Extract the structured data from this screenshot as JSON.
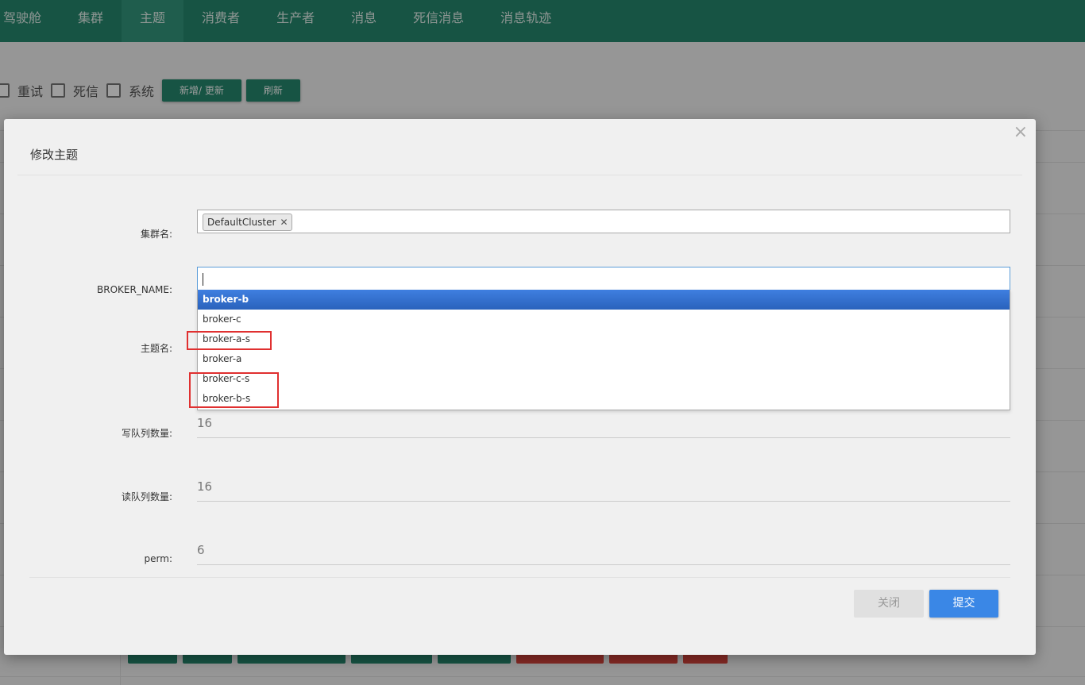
{
  "nav": {
    "items": [
      {
        "label": "驾驶舱"
      },
      {
        "label": "集群"
      },
      {
        "label": "主题"
      },
      {
        "label": "消费者"
      },
      {
        "label": "生产者"
      },
      {
        "label": "消息"
      },
      {
        "label": "死信消息"
      },
      {
        "label": "消息轨迹"
      }
    ],
    "active_index": 2
  },
  "filters": {
    "checkboxes": [
      {
        "label": "重试"
      },
      {
        "label": "死信"
      },
      {
        "label": "系统"
      }
    ],
    "add_update_label": "新增/ 更新",
    "refresh_label": "刷新"
  },
  "modal": {
    "title": "修改主题",
    "close_icon": "×",
    "cluster_label": "集群名:",
    "cluster_tag": "DefaultCluster",
    "cluster_tag_remove": "✕",
    "broker_label": "BROKER_NAME:",
    "broker_search_value": "",
    "broker_options": [
      {
        "label": "broker-b"
      },
      {
        "label": "broker-c"
      },
      {
        "label": "broker-a-s"
      },
      {
        "label": "broker-a"
      },
      {
        "label": "broker-c-s"
      },
      {
        "label": "broker-b-s"
      }
    ],
    "broker_highlighted_index": 0,
    "topic_label": "主题名:",
    "write_queue_label": "写队列数量:",
    "write_queue_value": "16",
    "read_queue_label": "读队列数量:",
    "read_queue_value": "16",
    "perm_label": "perm:",
    "perm_value": "6",
    "close_button": "关闭",
    "submit_button": "提交"
  },
  "colors": {
    "nav_bg": "#26886e",
    "primary": "#3a87e6",
    "danger": "#d9453d",
    "highlight": "#3875d7",
    "annotation": "#e03030"
  }
}
